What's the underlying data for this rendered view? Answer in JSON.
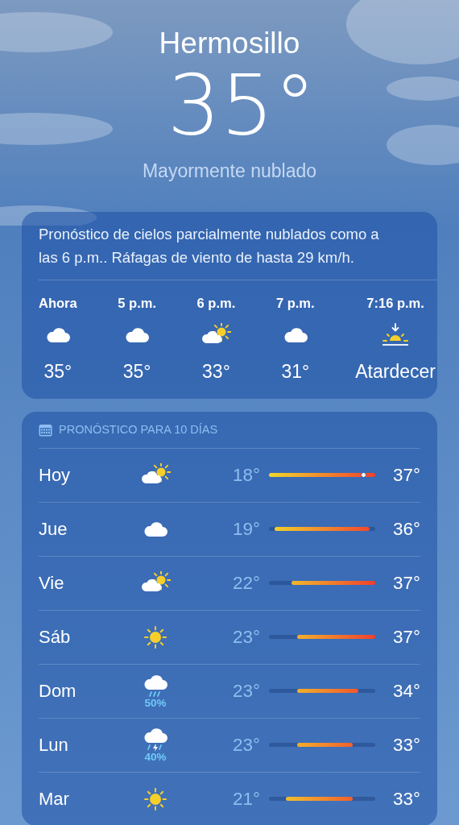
{
  "location": {
    "city": "Hermosillo",
    "temperature": "35°",
    "condition": "Mayormente nublado"
  },
  "hourly": {
    "summary": "Pronóstico de cielos parcialmente nublados como a las 6 p.m.. Ráfagas de viento de hasta 29 km/h.",
    "items": [
      {
        "time": "Ahora",
        "kind": "cloud",
        "value": "35°"
      },
      {
        "time": "5 p.m.",
        "kind": "cloud",
        "value": "35°"
      },
      {
        "time": "6 p.m.",
        "kind": "partly",
        "value": "33°"
      },
      {
        "time": "7 p.m.",
        "kind": "cloud",
        "value": "31°"
      },
      {
        "time": "7:16 p.m.",
        "kind": "sunset",
        "value": "Atardecer"
      }
    ]
  },
  "daily": {
    "title": "PRONÓSTICO PARA 10 DÍAS",
    "days": [
      {
        "day": "Hoy",
        "kind": "partly",
        "low": "18°",
        "high": "37°",
        "now_marker": true
      },
      {
        "day": "Jue",
        "kind": "cloud",
        "low": "19°",
        "high": "36°",
        "now_marker": false
      },
      {
        "day": "Vie",
        "kind": "partly",
        "low": "22°",
        "high": "37°",
        "now_marker": false
      },
      {
        "day": "Sáb",
        "kind": "sun",
        "low": "23°",
        "high": "37°",
        "now_marker": false
      },
      {
        "day": "Dom",
        "kind": "rain",
        "precip": "50%",
        "low": "23°",
        "high": "34°",
        "now_marker": false
      },
      {
        "day": "Lun",
        "kind": "storm",
        "precip": "40%",
        "low": "23°",
        "high": "33°",
        "now_marker": false
      },
      {
        "day": "Mar",
        "kind": "sun",
        "low": "21°",
        "high": "33°",
        "now_marker": false
      }
    ]
  }
}
